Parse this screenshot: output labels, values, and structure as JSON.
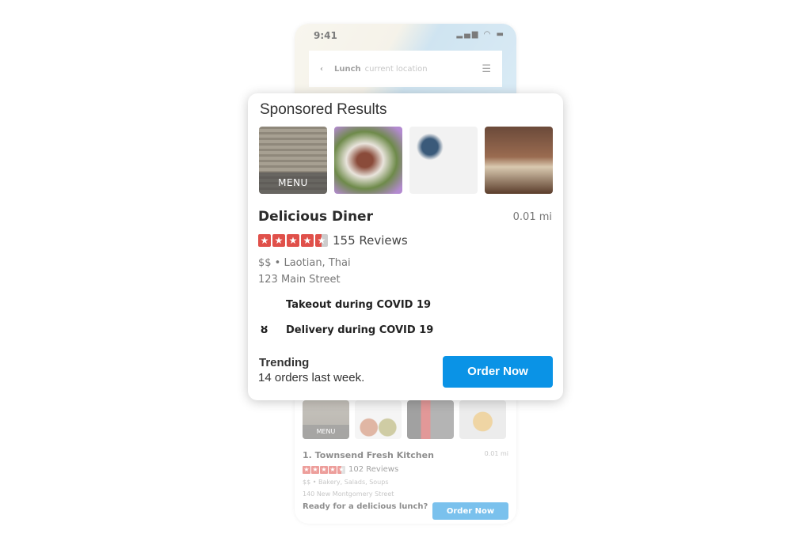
{
  "background_phone": {
    "status_time": "9:41",
    "status_icons": "signal-wifi-battery",
    "search": {
      "query": "Lunch",
      "location": "current location"
    },
    "listing": {
      "photos": [
        {
          "tag": "MENU"
        },
        {},
        {},
        {}
      ],
      "name": "1. Townsend Fresh Kitchen",
      "distance": "0.01 mi",
      "rating": 4.5,
      "reviews": "102 Reviews",
      "price_category": "$$ • Bakery, Salads, Soups",
      "address": "140 New Montgomery Street",
      "prompt": "Ready for a delicious lunch?",
      "order_label": "Order Now"
    }
  },
  "card": {
    "title": "Sponsored Results",
    "photos": [
      {
        "tag": "MENU"
      },
      {},
      {},
      {}
    ],
    "name": "Delicious Diner",
    "distance": "0.01 mi",
    "rating": 4.5,
    "reviews": "155 Reviews",
    "price_category": "$$ •  Laotian, Thai",
    "address": "123 Main Street",
    "features": [
      "Takeout during COVID 19",
      "Delivery during COVID 19"
    ],
    "trending_title": "Trending",
    "trending_text": "14 orders last week.",
    "order_label": "Order Now",
    "colors": {
      "accent": "#0a93e6",
      "stars": "#e0504a"
    }
  }
}
